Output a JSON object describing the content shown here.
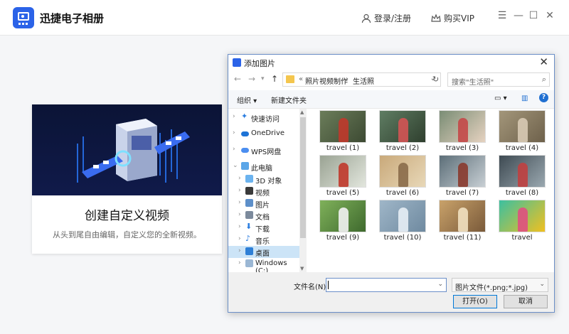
{
  "app": {
    "title": "迅捷电子相册",
    "login_label": "登录/注册",
    "vip_label": "购买VIP",
    "brand_color": "#2b63e8"
  },
  "card": {
    "title": "创建自定义视频",
    "subtitle": "从头到尾自由编辑，自定义您的全新视频。"
  },
  "dialog": {
    "title": "添加图片",
    "breadcrumb": [
      "照片视频制作",
      "生活照"
    ],
    "breadcrumb_prefix": "«",
    "search_placeholder": "搜索\"生活照\"",
    "organize_label": "组织 ▾",
    "new_folder_label": "新建文件夹",
    "tree": [
      {
        "label": "快速访问",
        "icon": "star-icon"
      },
      {
        "label": "OneDrive",
        "icon": "cloud-icon"
      },
      {
        "label": "WPS网盘",
        "icon": "cloud-icon"
      },
      {
        "label": "此电脑",
        "icon": "computer-icon"
      },
      {
        "label": "3D 对象",
        "icon": "cube-icon"
      },
      {
        "label": "视频",
        "icon": "video-icon"
      },
      {
        "label": "图片",
        "icon": "picture-icon"
      },
      {
        "label": "文档",
        "icon": "document-icon"
      },
      {
        "label": "下载",
        "icon": "download-icon"
      },
      {
        "label": "音乐",
        "icon": "music-icon"
      },
      {
        "label": "桌面",
        "icon": "desktop-icon"
      },
      {
        "label": "Windows (C:)",
        "icon": "drive-icon"
      }
    ],
    "files": [
      "travel (1)",
      "travel (2)",
      "travel (3)",
      "travel (4)",
      "travel (5)",
      "travel (6)",
      "travel (7)",
      "travel (8)",
      "travel (9)",
      "travel (10)",
      "travel (11)",
      "travel"
    ],
    "filename_label": "文件名(N):",
    "filename_value": "",
    "filetype_value": "图片文件(*.png;*.jpg)",
    "open_label": "打开(O)",
    "cancel_label": "取消"
  }
}
